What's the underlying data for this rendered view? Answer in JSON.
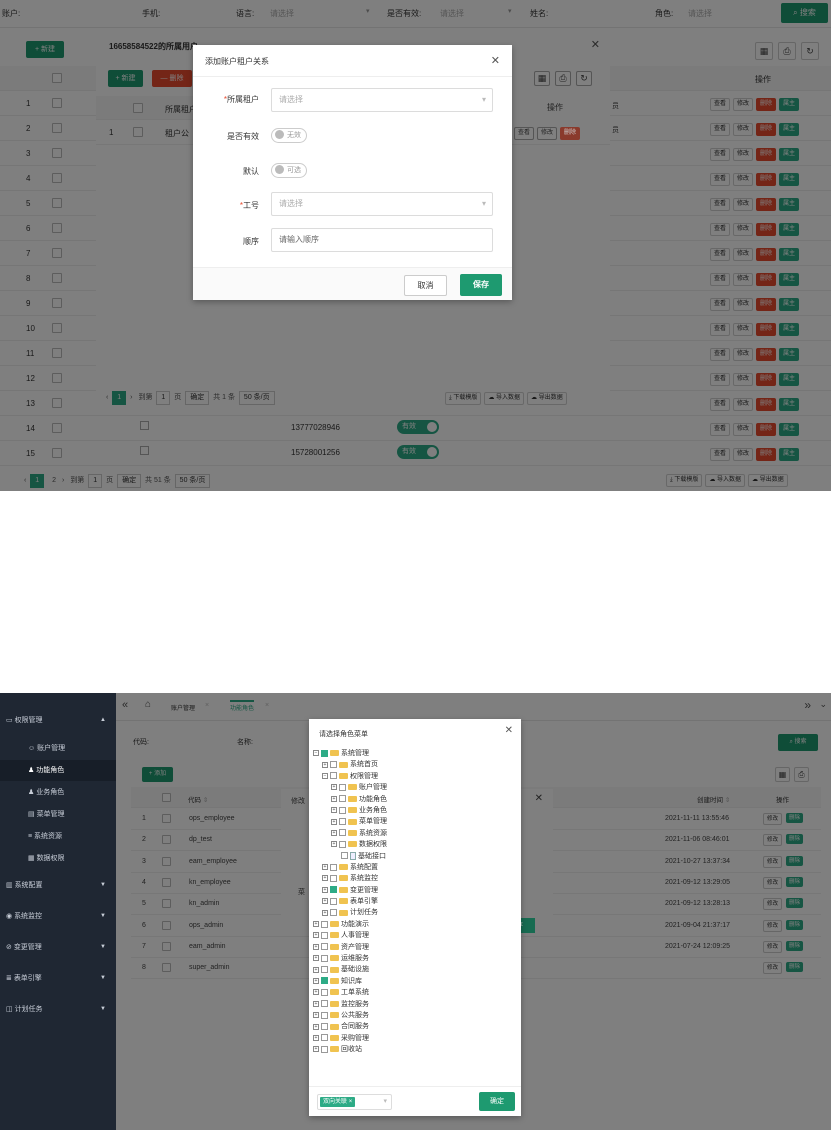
{
  "shot1": {
    "filters": {
      "account": "账户:",
      "phone": "手机:",
      "language": "语言:",
      "language_ph": "请选择",
      "valid": "是否有效:",
      "valid_ph": "请选择",
      "name": "姓名:",
      "role": "角色:",
      "role_ph": "请选择",
      "search": "搜索"
    },
    "toolbar": {
      "new": "+ 新建"
    },
    "ops_header": "操作",
    "row_numbers": [
      "1",
      "2",
      "3",
      "4",
      "5",
      "6",
      "7",
      "8",
      "9",
      "10",
      "11",
      "12",
      "13",
      "14",
      "15"
    ],
    "row_actions": {
      "view": "查看",
      "edit": "修改",
      "delete": "删除",
      "tenant": "属主"
    },
    "row14_phone": "13777028946",
    "row15_phone": "15728001256",
    "valid_badge": "有效",
    "pager": {
      "cur": "1",
      "next": "2",
      "goto": "到第",
      "goto_val": "1",
      "page": "页",
      "confirm": "确定",
      "total": "共 51 条",
      "size": "50 条/页",
      "download": "下载模版",
      "import": "导入数据",
      "export": "导出数据"
    },
    "tenant_dialog": {
      "title": "16658584522的所属用户",
      "new": "+ 新建",
      "delete": "— 删除",
      "col_tenant": "所属租户",
      "col_ops": "操作",
      "row_num": "1",
      "row_tenant": "租户公",
      "view": "查看",
      "edit": "修改",
      "delete_btn": "删除",
      "pager": {
        "cur": "1",
        "goto": "到第",
        "goto_val": "1",
        "page": "页",
        "confirm": "确定",
        "total": "共 1 条",
        "size": "50 条/页",
        "download": "下载模版",
        "import": "导入数据",
        "export": "导出数据"
      }
    },
    "add_dialog": {
      "title": "添加账户租户关系",
      "tenant_label": "所属租户",
      "tenant_ph": "请选择",
      "valid_label": "是否有效",
      "valid_value": "无效",
      "default_label": "默认",
      "default_value": "可选",
      "jobno_label": "工号",
      "jobno_ph": "请选择",
      "order_label": "顺序",
      "order_ph": "请输入顺序",
      "cancel": "取消",
      "save": "保存"
    },
    "partial_text": {
      "a": "员",
      "b": "员"
    }
  },
  "shot2": {
    "sidebar": {
      "items": [
        {
          "label": "权限管理",
          "icon": "folder-icon"
        },
        {
          "label": "账户管理",
          "icon": "user-icon"
        },
        {
          "label": "功能角色",
          "icon": "role-icon"
        },
        {
          "label": "业务角色",
          "icon": "role-icon"
        },
        {
          "label": "菜单管理",
          "icon": "menu-icon"
        },
        {
          "label": "系统资源",
          "icon": "list-icon"
        },
        {
          "label": "数据权限",
          "icon": "data-icon"
        },
        {
          "label": "系统配置",
          "icon": "config-icon"
        },
        {
          "label": "系统监控",
          "icon": "monitor-icon"
        },
        {
          "label": "变更管理",
          "icon": "change-icon"
        },
        {
          "label": "表单引擎",
          "icon": "form-icon"
        },
        {
          "label": "计划任务",
          "icon": "task-icon"
        }
      ]
    },
    "tabs": {
      "account": "账户管理",
      "role": "功能角色"
    },
    "filters": {
      "code": "代码:",
      "name": "名称:",
      "search": "搜索"
    },
    "add": "+ 添加",
    "columns": {
      "code": "代码",
      "created": "创建时间",
      "ops": "操作"
    },
    "rows": [
      {
        "n": "1",
        "code": "ops_employee",
        "time": "2021-11-11 13:55:46"
      },
      {
        "n": "2",
        "code": "dp_test",
        "time": "2021-11-06 08:46:01"
      },
      {
        "n": "3",
        "code": "eam_employee",
        "time": "2021-10-27 13:37:34"
      },
      {
        "n": "4",
        "code": "kn_employee",
        "time": "2021-09-12 13:29:05"
      },
      {
        "n": "5",
        "code": "kn_admin",
        "time": "2021-09-12 13:28:13"
      },
      {
        "n": "6",
        "code": "ops_admin",
        "time": "2021-09-04 21:37:17"
      },
      {
        "n": "7",
        "code": "eam_admin",
        "time": "2021-07-24 12:09:25"
      },
      {
        "n": "8",
        "code": "super_admin",
        "time": ""
      }
    ],
    "row_actions": {
      "edit": "修改",
      "delete": "删除"
    },
    "behind_dialog": {
      "title": "修改",
      "c": "菜",
      "save": "存"
    },
    "menu_dialog": {
      "title": "请选择角色菜单",
      "tree": [
        {
          "d": 0,
          "exp": "⊟",
          "cb": true,
          "label": "系统管理"
        },
        {
          "d": 1,
          "exp": "⊞",
          "cb": false,
          "label": "系统首页"
        },
        {
          "d": 1,
          "exp": "⊟",
          "cb": false,
          "label": "权限管理"
        },
        {
          "d": 2,
          "exp": "⊞",
          "cb": false,
          "label": "账户管理"
        },
        {
          "d": 2,
          "exp": "⊞",
          "cb": false,
          "label": "功能角色"
        },
        {
          "d": 2,
          "exp": "⊞",
          "cb": false,
          "label": "业务角色"
        },
        {
          "d": 2,
          "exp": "⊞",
          "cb": false,
          "label": "菜单管理"
        },
        {
          "d": 2,
          "exp": "⊞",
          "cb": false,
          "label": "系统资源"
        },
        {
          "d": 2,
          "exp": "⊞",
          "cb": false,
          "label": "数据权限"
        },
        {
          "d": 2,
          "exp": "",
          "cb": false,
          "label": "基础接口",
          "doc": true
        },
        {
          "d": 1,
          "exp": "⊞",
          "cb": false,
          "label": "系统配置"
        },
        {
          "d": 1,
          "exp": "⊞",
          "cb": false,
          "label": "系统监控"
        },
        {
          "d": 1,
          "exp": "⊞",
          "cb": true,
          "label": "变更管理"
        },
        {
          "d": 1,
          "exp": "⊞",
          "cb": false,
          "label": "表单引擎"
        },
        {
          "d": 1,
          "exp": "⊞",
          "cb": false,
          "label": "计划任务"
        },
        {
          "d": 0,
          "exp": "⊞",
          "cb": false,
          "label": "功能演示"
        },
        {
          "d": 0,
          "exp": "⊞",
          "cb": false,
          "label": "人事管理"
        },
        {
          "d": 0,
          "exp": "⊞",
          "cb": false,
          "label": "资产管理"
        },
        {
          "d": 0,
          "exp": "⊞",
          "cb": false,
          "label": "运维服务"
        },
        {
          "d": 0,
          "exp": "⊞",
          "cb": false,
          "label": "基础设施"
        },
        {
          "d": 0,
          "exp": "⊞",
          "cb": true,
          "label": "知识库"
        },
        {
          "d": 0,
          "exp": "⊞",
          "cb": false,
          "label": "工单系统"
        },
        {
          "d": 0,
          "exp": "⊞",
          "cb": false,
          "label": "监控服务"
        },
        {
          "d": 0,
          "exp": "⊞",
          "cb": false,
          "label": "公共服务"
        },
        {
          "d": 0,
          "exp": "⊞",
          "cb": false,
          "label": "合同服务"
        },
        {
          "d": 0,
          "exp": "⊞",
          "cb": false,
          "label": "采购管理"
        },
        {
          "d": 0,
          "exp": "⊞",
          "cb": false,
          "label": "回收站"
        }
      ],
      "tag": "双向关联",
      "confirm": "确定"
    }
  }
}
